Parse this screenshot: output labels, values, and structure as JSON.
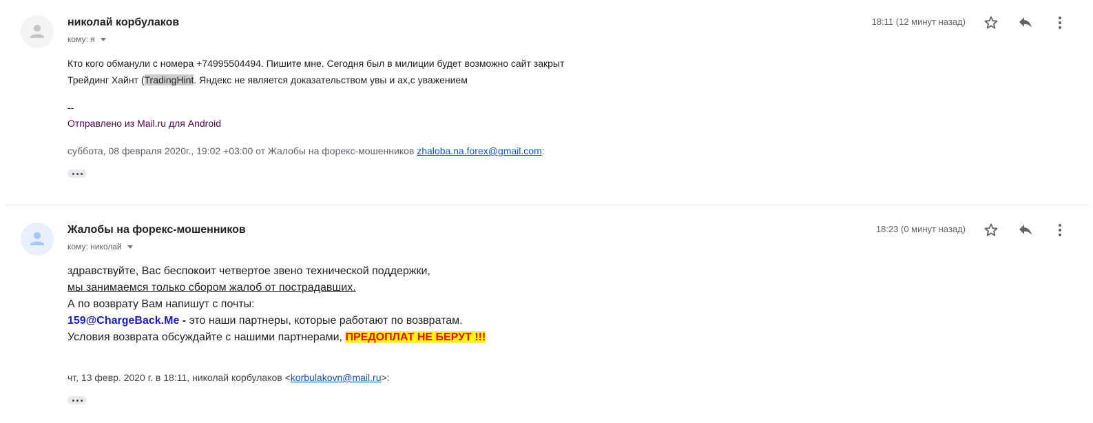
{
  "messages": [
    {
      "sender": "николай корбулаков",
      "to": "кому: я",
      "time": "18:11 (12 минут назад)",
      "body_line1": "Кто кого обманули  с номера +74995504494. Пишите  мне. Сегодня был в милиции  будет возможно сайт закрыт",
      "body_line2_pre": "Трейдинг Хайнт (",
      "body_line2_highlight": "TradingHint",
      "body_line2_post": ". Яндекс не является доказательством увы и ах,с уважением",
      "sig_dash": "--",
      "sig_text": "Отправлено из Mail.ru для Android",
      "quote_pre": "суббота, 08 февраля 2020г., 19:02 +03:00 от Жалобы на форекс-мошенников ",
      "quote_email": "zhaloba.na.forex@gmail.com",
      "quote_post": ":"
    },
    {
      "sender": "Жалобы на форекс-мошенников",
      "to": "кому: николай",
      "time": "18:23 (0 минут назад)",
      "line1": "здравствуйте, Вас беспокоит четвертое звено технической поддержки,",
      "line2": "мы занимаемся только сбором жалоб от пострадавших.",
      "line3": "А по возврату Вам напишут с почты:",
      "line4_email": "159@ChargeBack.Me",
      "line4_dash": " -",
      "line4_rest": " это наши партнеры, которые работают по возвратам.",
      "line5_pre": "Условия возврата обсуждайте с нашими партнерами, ",
      "line5_warn": "ПРЕДОПЛАТ НЕ БЕРУТ !!!",
      "quote_pre": "чт, 13 февр. 2020 г. в 18:11, николай корбулаков <",
      "quote_email": "korbulakovn@mail.ru",
      "quote_post": ">:"
    }
  ],
  "icons": {
    "star": "star-icon",
    "reply": "reply-icon",
    "more": "more-vert-icon",
    "avatar": "person-icon",
    "expand": "ellipsis-icon"
  },
  "colors": {
    "link": "#1155cc",
    "signature": "#500050",
    "warning_text": "#ff0000",
    "warning_bg": "#ffff00",
    "partner_email": "#1a1ad6"
  }
}
